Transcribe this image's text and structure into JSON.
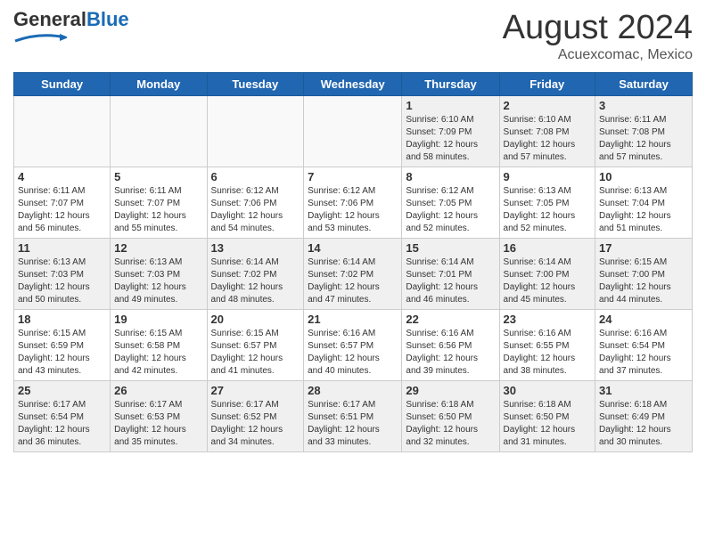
{
  "header": {
    "logo_general": "General",
    "logo_blue": "Blue",
    "main_title": "August 2024",
    "subtitle": "Acuexcomac, Mexico"
  },
  "days_of_week": [
    "Sunday",
    "Monday",
    "Tuesday",
    "Wednesday",
    "Thursday",
    "Friday",
    "Saturday"
  ],
  "weeks": [
    [
      {
        "day": "",
        "empty": true
      },
      {
        "day": "",
        "empty": true
      },
      {
        "day": "",
        "empty": true
      },
      {
        "day": "",
        "empty": true
      },
      {
        "day": "1",
        "sunrise": "6:10 AM",
        "sunset": "7:09 PM",
        "daylight": "12 hours and 58 minutes."
      },
      {
        "day": "2",
        "sunrise": "6:10 AM",
        "sunset": "7:08 PM",
        "daylight": "12 hours and 57 minutes."
      },
      {
        "day": "3",
        "sunrise": "6:11 AM",
        "sunset": "7:08 PM",
        "daylight": "12 hours and 57 minutes."
      }
    ],
    [
      {
        "day": "4",
        "sunrise": "6:11 AM",
        "sunset": "7:07 PM",
        "daylight": "12 hours and 56 minutes."
      },
      {
        "day": "5",
        "sunrise": "6:11 AM",
        "sunset": "7:07 PM",
        "daylight": "12 hours and 55 minutes."
      },
      {
        "day": "6",
        "sunrise": "6:12 AM",
        "sunset": "7:06 PM",
        "daylight": "12 hours and 54 minutes."
      },
      {
        "day": "7",
        "sunrise": "6:12 AM",
        "sunset": "7:06 PM",
        "daylight": "12 hours and 53 minutes."
      },
      {
        "day": "8",
        "sunrise": "6:12 AM",
        "sunset": "7:05 PM",
        "daylight": "12 hours and 52 minutes."
      },
      {
        "day": "9",
        "sunrise": "6:13 AM",
        "sunset": "7:05 PM",
        "daylight": "12 hours and 52 minutes."
      },
      {
        "day": "10",
        "sunrise": "6:13 AM",
        "sunset": "7:04 PM",
        "daylight": "12 hours and 51 minutes."
      }
    ],
    [
      {
        "day": "11",
        "sunrise": "6:13 AM",
        "sunset": "7:03 PM",
        "daylight": "12 hours and 50 minutes."
      },
      {
        "day": "12",
        "sunrise": "6:13 AM",
        "sunset": "7:03 PM",
        "daylight": "12 hours and 49 minutes."
      },
      {
        "day": "13",
        "sunrise": "6:14 AM",
        "sunset": "7:02 PM",
        "daylight": "12 hours and 48 minutes."
      },
      {
        "day": "14",
        "sunrise": "6:14 AM",
        "sunset": "7:02 PM",
        "daylight": "12 hours and 47 minutes."
      },
      {
        "day": "15",
        "sunrise": "6:14 AM",
        "sunset": "7:01 PM",
        "daylight": "12 hours and 46 minutes."
      },
      {
        "day": "16",
        "sunrise": "6:14 AM",
        "sunset": "7:00 PM",
        "daylight": "12 hours and 45 minutes."
      },
      {
        "day": "17",
        "sunrise": "6:15 AM",
        "sunset": "7:00 PM",
        "daylight": "12 hours and 44 minutes."
      }
    ],
    [
      {
        "day": "18",
        "sunrise": "6:15 AM",
        "sunset": "6:59 PM",
        "daylight": "12 hours and 43 minutes."
      },
      {
        "day": "19",
        "sunrise": "6:15 AM",
        "sunset": "6:58 PM",
        "daylight": "12 hours and 42 minutes."
      },
      {
        "day": "20",
        "sunrise": "6:15 AM",
        "sunset": "6:57 PM",
        "daylight": "12 hours and 41 minutes."
      },
      {
        "day": "21",
        "sunrise": "6:16 AM",
        "sunset": "6:57 PM",
        "daylight": "12 hours and 40 minutes."
      },
      {
        "day": "22",
        "sunrise": "6:16 AM",
        "sunset": "6:56 PM",
        "daylight": "12 hours and 39 minutes."
      },
      {
        "day": "23",
        "sunrise": "6:16 AM",
        "sunset": "6:55 PM",
        "daylight": "12 hours and 38 minutes."
      },
      {
        "day": "24",
        "sunrise": "6:16 AM",
        "sunset": "6:54 PM",
        "daylight": "12 hours and 37 minutes."
      }
    ],
    [
      {
        "day": "25",
        "sunrise": "6:17 AM",
        "sunset": "6:54 PM",
        "daylight": "12 hours and 36 minutes."
      },
      {
        "day": "26",
        "sunrise": "6:17 AM",
        "sunset": "6:53 PM",
        "daylight": "12 hours and 35 minutes."
      },
      {
        "day": "27",
        "sunrise": "6:17 AM",
        "sunset": "6:52 PM",
        "daylight": "12 hours and 34 minutes."
      },
      {
        "day": "28",
        "sunrise": "6:17 AM",
        "sunset": "6:51 PM",
        "daylight": "12 hours and 33 minutes."
      },
      {
        "day": "29",
        "sunrise": "6:18 AM",
        "sunset": "6:50 PM",
        "daylight": "12 hours and 32 minutes."
      },
      {
        "day": "30",
        "sunrise": "6:18 AM",
        "sunset": "6:50 PM",
        "daylight": "12 hours and 31 minutes."
      },
      {
        "day": "31",
        "sunrise": "6:18 AM",
        "sunset": "6:49 PM",
        "daylight": "12 hours and 30 minutes."
      }
    ]
  ]
}
